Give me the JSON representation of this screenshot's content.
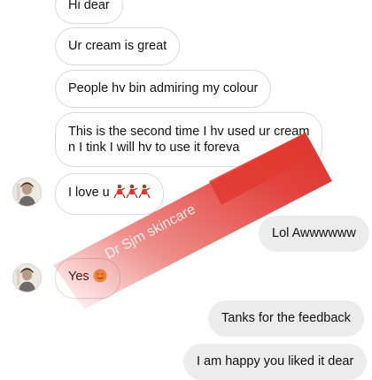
{
  "messages": {
    "m1": "Hi dear",
    "m2": "Ur cream is great",
    "m3": "People hv bin admiring my colour",
    "m4_line1": "This is the second time I hv used ur cream",
    "m4_line2": "n I tink I will hv to use it foreva",
    "m5": "I love u",
    "r1": "Lol Awwwwww",
    "m6": "Yes",
    "r2": "Tanks for the feedback",
    "r3": "I am happy you liked it dear"
  },
  "emojis": {
    "m5": [
      "dancer-emoji",
      "dancer-emoji",
      "dancer-emoji"
    ],
    "m6": "smile-emoji"
  },
  "watermark": {
    "text": "Dr Sjm skincare",
    "color": "#e0302a"
  },
  "colors": {
    "incoming_bg": "#ffffff",
    "outgoing_bg": "#ececec",
    "border": "#d9d9d9"
  }
}
